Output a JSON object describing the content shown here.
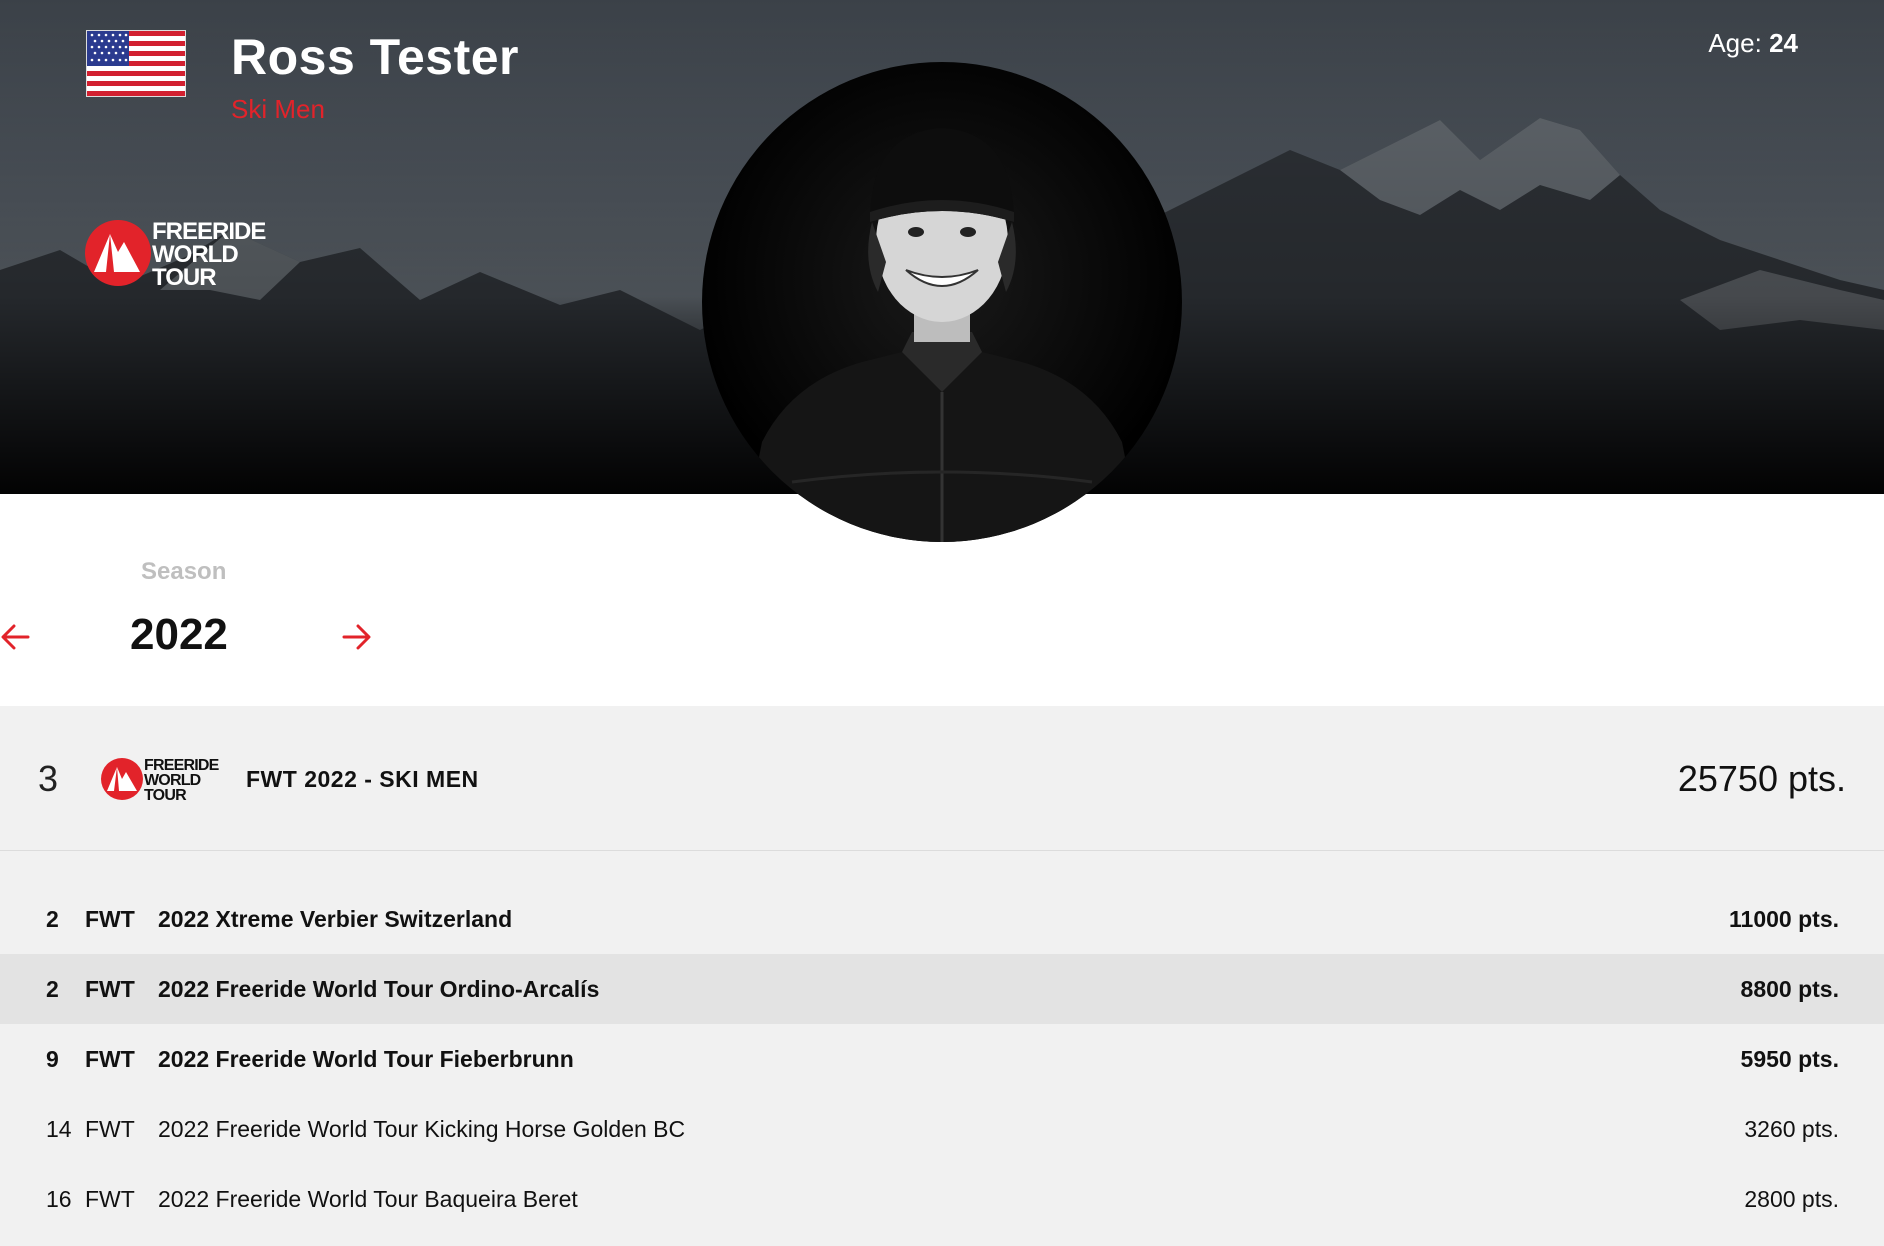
{
  "header": {
    "athlete_name": "Ross Tester",
    "category": "Ski Men",
    "age_label": "Age:",
    "age_value": "24",
    "logo_text": [
      "FREERIDE",
      "WORLD",
      "TOUR"
    ]
  },
  "season": {
    "label": "Season",
    "year": "2022"
  },
  "ranking": {
    "rank": "3",
    "title": "FWT 2022 - SKI MEN",
    "points": "25750 pts.",
    "events": [
      {
        "rank": "2",
        "tour": "FWT",
        "name": "2022 Xtreme Verbier Switzerland",
        "points": "11000 pts."
      },
      {
        "rank": "2",
        "tour": "FWT",
        "name": "2022 Freeride World Tour Ordino-Arcalís",
        "points": "8800 pts."
      },
      {
        "rank": "9",
        "tour": "FWT",
        "name": "2022 Freeride World Tour Fieberbrunn",
        "points": "5950 pts."
      },
      {
        "rank": "14",
        "tour": "FWT",
        "name": "2022 Freeride World Tour Kicking Horse Golden BC",
        "points": "3260 pts."
      },
      {
        "rank": "16",
        "tour": "FWT",
        "name": "2022 Freeride World Tour Baqueira Beret",
        "points": "2800 pts."
      }
    ]
  },
  "colors": {
    "accent": "#e2232a",
    "row_background": "#f1f1f1",
    "row_highlight": "#e3e3e3"
  },
  "icons": [
    "us-flag-icon",
    "fwt-logo-icon",
    "arrow-left-icon",
    "arrow-right-icon"
  ]
}
